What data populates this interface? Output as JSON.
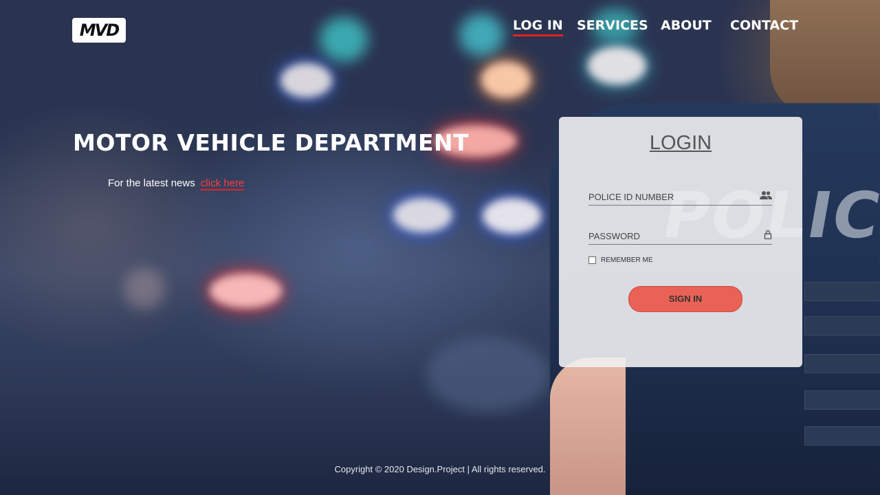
{
  "logo": {
    "text": "MVD"
  },
  "nav": [
    {
      "label": "LOG IN",
      "active": true
    },
    {
      "label": "SERVICES",
      "active": false
    },
    {
      "label": "ABOUT",
      "active": false
    },
    {
      "label": "CONTACT",
      "active": false
    }
  ],
  "hero": {
    "title": "MOTOR VEHICLE DEPARTMENT",
    "news_prefix": "For the latest news",
    "news_link": "click here"
  },
  "background": {
    "badge_text": "POLICE"
  },
  "login": {
    "title": "LOGIN",
    "id_label": "POLICE ID NUMBER",
    "id_icon": "users-icon",
    "password_label": "PASSWORD",
    "password_icon": "lock-icon",
    "remember_label": "REMEMBER ME",
    "submit_label": "SIGN IN"
  },
  "footer": {
    "copyright": "Copyright © 2020 Design.Project | All rights reserved."
  },
  "colors": {
    "accent_red": "#e02424",
    "button": "#ea6155"
  }
}
